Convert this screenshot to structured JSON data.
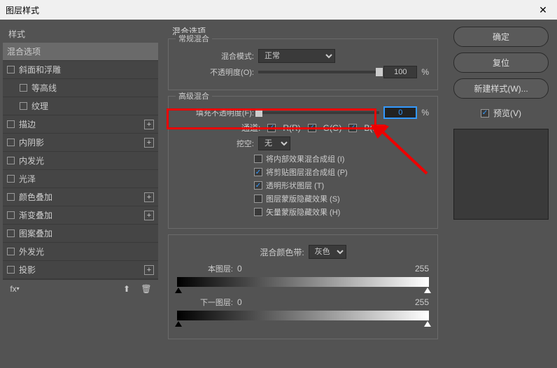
{
  "window": {
    "title": "图层样式"
  },
  "left": {
    "header": "样式",
    "items": [
      {
        "label": "混合选项",
        "type": "plain",
        "active": true
      },
      {
        "label": "斜面和浮雕",
        "type": "check"
      },
      {
        "label": "等高线",
        "type": "check",
        "sub": true
      },
      {
        "label": "纹理",
        "type": "check",
        "sub": true
      },
      {
        "label": "描边",
        "type": "check",
        "add": true
      },
      {
        "label": "内阴影",
        "type": "check",
        "add": true
      },
      {
        "label": "内发光",
        "type": "check"
      },
      {
        "label": "光泽",
        "type": "check"
      },
      {
        "label": "颜色叠加",
        "type": "check",
        "add": true
      },
      {
        "label": "渐变叠加",
        "type": "check",
        "add": true
      },
      {
        "label": "图案叠加",
        "type": "check"
      },
      {
        "label": "外发光",
        "type": "check"
      },
      {
        "label": "投影",
        "type": "check",
        "add": true
      }
    ]
  },
  "center": {
    "title": "混合选项",
    "general": {
      "legend": "常规混合",
      "blend_mode_label": "混合模式:",
      "blend_mode_value": "正常",
      "opacity_label": "不透明度(O):",
      "opacity_value": "100",
      "percent": "%"
    },
    "advanced": {
      "legend": "高级混合",
      "fill_label": "填充不透明度(F):",
      "fill_value": "0",
      "percent": "%",
      "channel_label": "通道:",
      "r": "R(R)",
      "g": "G(G)",
      "b": "B(B)",
      "knockout_label": "挖空:",
      "knockout_value": "无",
      "opt1": "将内部效果混合成组 (I)",
      "opt2": "将剪贴图层混合成组 (P)",
      "opt3": "透明形状图层 (T)",
      "opt4": "图层蒙版隐藏效果 (S)",
      "opt5": "矢量蒙版隐藏效果 (H)"
    },
    "blendif": {
      "label": "混合颜色带:",
      "value": "灰色",
      "this_layer": "本图层:",
      "under_layer": "下一图层:",
      "min": "0",
      "max": "255"
    }
  },
  "right": {
    "ok": "确定",
    "cancel": "复位",
    "new_style": "新建样式(W)...",
    "preview": "预览(V)"
  }
}
